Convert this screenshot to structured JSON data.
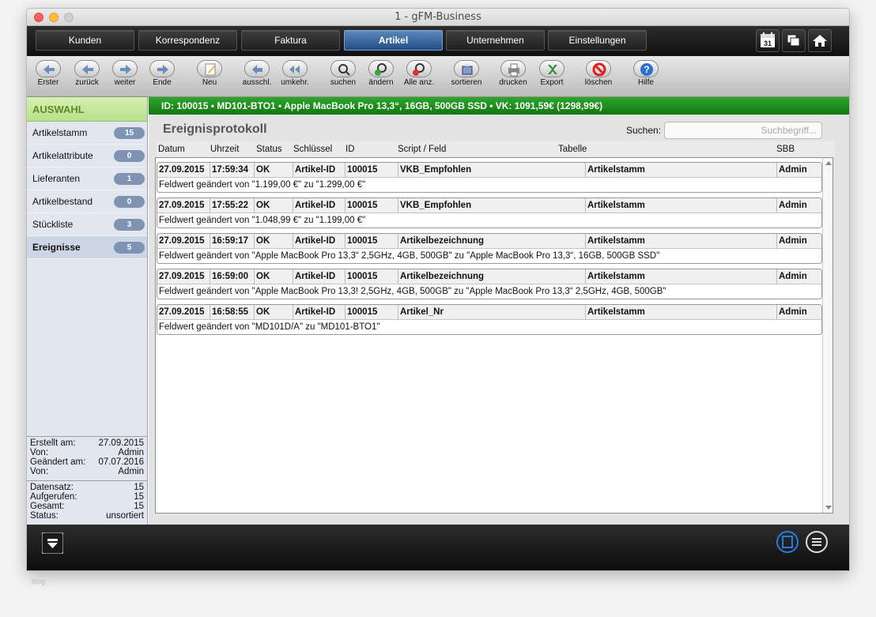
{
  "window": {
    "title": "1 - gFM-Business"
  },
  "nav": {
    "tabs": [
      {
        "label": "Kunden",
        "active": false
      },
      {
        "label": "Korrespondenz",
        "active": false
      },
      {
        "label": "Faktura",
        "active": false
      },
      {
        "label": "Artikel",
        "active": true
      },
      {
        "label": "Unternehmen",
        "active": false
      },
      {
        "label": "Einstellungen",
        "active": false
      }
    ],
    "calendar_day": "31",
    "icons": [
      "calendar-icon",
      "windows-icon",
      "home-icon"
    ]
  },
  "toolbar": {
    "items": [
      {
        "label": "Erster",
        "icon": "first-record-icon"
      },
      {
        "label": "zurück",
        "icon": "back-arrow-icon"
      },
      {
        "label": "weiter",
        "icon": "forward-arrow-icon"
      },
      {
        "label": "Ende",
        "icon": "last-record-icon"
      },
      {
        "label": "Neu",
        "icon": "new-note-icon"
      },
      {
        "label": "ausschl.",
        "icon": "omit-icon"
      },
      {
        "label": "umkehr.",
        "icon": "invert-icon"
      },
      {
        "label": "suchen",
        "icon": "search-icon"
      },
      {
        "label": "ändern",
        "icon": "modify-find-icon"
      },
      {
        "label": "Alle anz.",
        "icon": "show-all-icon"
      },
      {
        "label": "sortieren",
        "icon": "sort-icon"
      },
      {
        "label": "drucken",
        "icon": "print-icon"
      },
      {
        "label": "Export",
        "icon": "export-icon"
      },
      {
        "label": "löschen",
        "icon": "delete-icon"
      },
      {
        "label": "Hilfe",
        "icon": "help-icon"
      }
    ]
  },
  "sidebar": {
    "header": "AUSWAHL",
    "items": [
      {
        "label": "Artikelstamm",
        "count": "15",
        "active": false
      },
      {
        "label": "Artikelattribute",
        "count": "0",
        "active": false
      },
      {
        "label": "Lieferanten",
        "count": "1",
        "active": false
      },
      {
        "label": "Artikelbestand",
        "count": "0",
        "active": false
      },
      {
        "label": "Stückliste",
        "count": "3",
        "active": false
      },
      {
        "label": "Ereignisse",
        "count": "5",
        "active": true
      }
    ],
    "meta1": [
      {
        "label": "Erstellt am:",
        "value": "27.09.2015"
      },
      {
        "label": "Von:",
        "value": "Admin"
      },
      {
        "label": "Geändert am:",
        "value": "07.07.2016"
      },
      {
        "label": "Von:",
        "value": "Admin"
      }
    ],
    "meta2": [
      {
        "label": "Datensatz:",
        "value": "15"
      },
      {
        "label": "Aufgerufen:",
        "value": "15"
      },
      {
        "label": "Gesamt:",
        "value": "15"
      },
      {
        "label": "Status:",
        "value": "unsortiert"
      }
    ]
  },
  "record_bar": "ID: 100015 • MD101-BTO1 • Apple MacBook Pro 13,3“, 16GB, 500GB SSD • VK: 1091,59€ (1298,99€)",
  "panel": {
    "title": "Ereignisprotokoll",
    "search_label": "Suchen:",
    "search_placeholder": "Suchbegriff...",
    "columns": [
      "Datum",
      "Uhrzeit",
      "Status",
      "Schlüssel",
      "ID",
      "Script / Feld",
      "Tabelle",
      "SBB"
    ],
    "events": [
      {
        "date": "27.09.2015",
        "time": "17:59:34",
        "status": "OK",
        "key": "Artikel-ID",
        "id": "100015",
        "field": "VKB_Empfohlen",
        "table": "Artikelstamm",
        "user": "Admin",
        "message": "Feldwert geändert von \"1.199,00 €\" zu \"1.299,00 €\""
      },
      {
        "date": "27.09.2015",
        "time": "17:55:22",
        "status": "OK",
        "key": "Artikel-ID",
        "id": "100015",
        "field": "VKB_Empfohlen",
        "table": "Artikelstamm",
        "user": "Admin",
        "message": "Feldwert geändert von \"1.048,99 €\" zu \"1.199,00 €\""
      },
      {
        "date": "27.09.2015",
        "time": "16:59:17",
        "status": "OK",
        "key": "Artikel-ID",
        "id": "100015",
        "field": "Artikelbezeichnung",
        "table": "Artikelstamm",
        "user": "Admin",
        "message": "Feldwert geändert von \"Apple MacBook Pro 13,3“ 2,5GHz, 4GB, 500GB\" zu \"Apple MacBook Pro 13,3“, 16GB, 500GB SSD\""
      },
      {
        "date": "27.09.2015",
        "time": "16:59:00",
        "status": "OK",
        "key": "Artikel-ID",
        "id": "100015",
        "field": "Artikelbezeichnung",
        "table": "Artikelstamm",
        "user": "Admin",
        "message": "Feldwert geändert von \"Apple MacBook Pro 13,3! 2,5GHz, 4GB, 500GB\" zu \"Apple MacBook Pro 13,3“ 2,5GHz, 4GB, 500GB\""
      },
      {
        "date": "27.09.2015",
        "time": "16:58:55",
        "status": "OK",
        "key": "Artikel-ID",
        "id": "100015",
        "field": "Artikel_Nr",
        "table": "Artikelstamm",
        "user": "Admin",
        "message": "Feldwert geändert von \"MD101D/A\" zu \"MD101-BTO1\""
      }
    ]
  },
  "bottom": {
    "icons": [
      "menu-drop-icon",
      "single-view-icon",
      "list-view-icon"
    ]
  },
  "caption": "blog"
}
